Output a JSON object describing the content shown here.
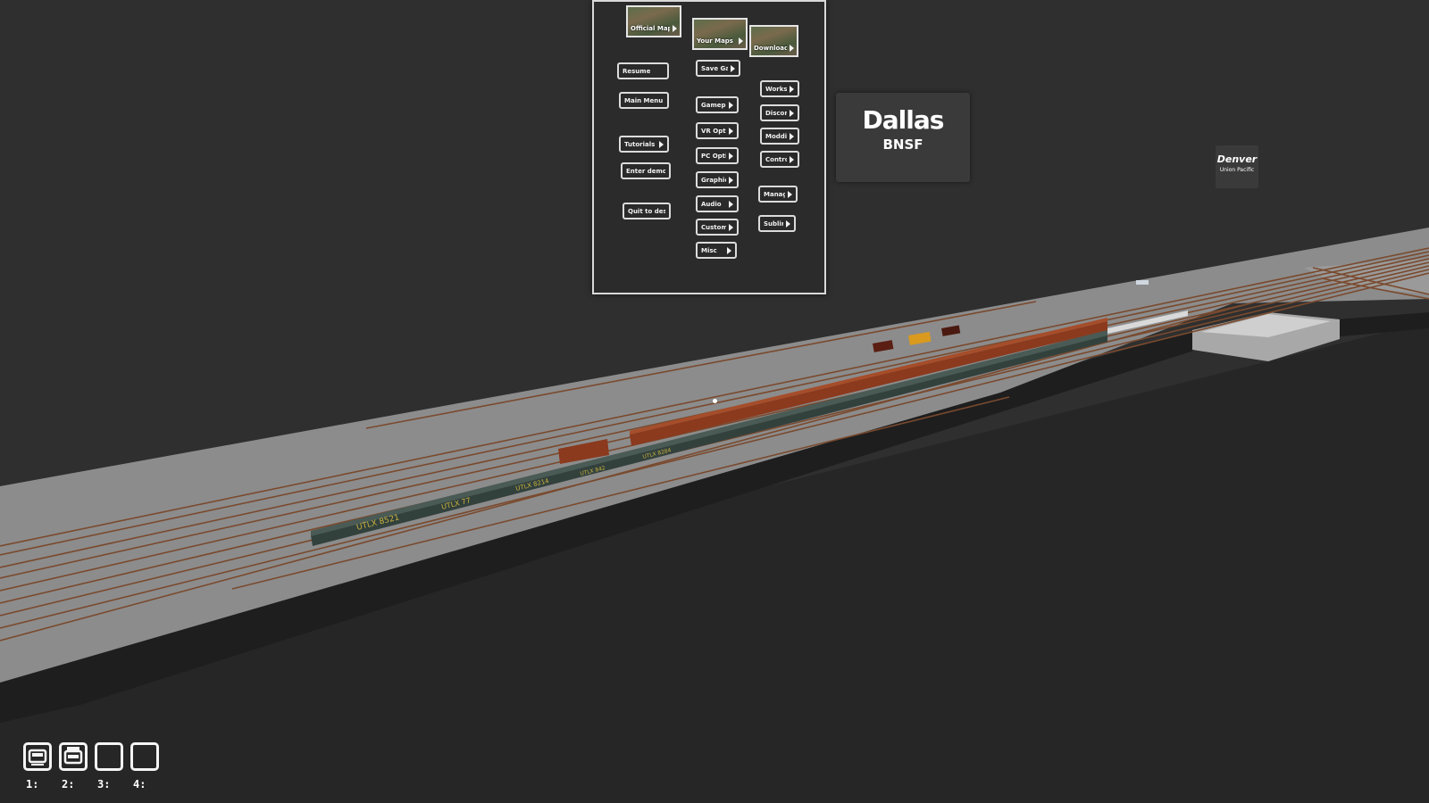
{
  "menu": {
    "map_tiles": [
      {
        "label": "Official Maps"
      },
      {
        "label": "Your Maps"
      },
      {
        "label": "Downloaded Maps"
      }
    ],
    "col1": [
      {
        "label": "Resume"
      },
      {
        "label": "Main Menu"
      },
      {
        "label": "Tutorials"
      },
      {
        "label": "Enter demo mode"
      },
      {
        "label": "Quit to desktop"
      }
    ],
    "col2": [
      {
        "label": "Save Game"
      },
      {
        "label": "Gameplay"
      },
      {
        "label": "VR Options"
      },
      {
        "label": "PC Options"
      },
      {
        "label": "Graphics"
      },
      {
        "label": "Audio"
      },
      {
        "label": "Custom Train"
      },
      {
        "label": "Misc"
      }
    ],
    "col3": [
      {
        "label": "Workshop"
      },
      {
        "label": "Discord"
      },
      {
        "label": "Modding"
      },
      {
        "label": "Controls"
      },
      {
        "label": "Manage Saves"
      },
      {
        "label": "Sublimator"
      }
    ]
  },
  "signs": {
    "dallas": {
      "city": "Dallas",
      "railroad": "BNSF"
    },
    "denver": {
      "city": "Denver",
      "railroad": "Union Pacific"
    }
  },
  "railcars": {
    "tank_markings": [
      "UTLX 8521",
      "UTLX 77",
      "UTLX 8214",
      "UTLX 842",
      "UTLX 8284"
    ]
  },
  "hotbar": {
    "slots": [
      {
        "num": "1:",
        "icon": "train-icon"
      },
      {
        "num": "2:",
        "icon": "caboose-icon"
      },
      {
        "num": "3:",
        "icon": "empty-slot-icon"
      },
      {
        "num": "4:",
        "icon": "empty-slot-icon"
      }
    ]
  },
  "colors": {
    "background": "#2f2f2f",
    "platform": "#8c8c8c",
    "track": "#7a4a2e",
    "boxcar": "#8b3a1e",
    "tankcar": "#33413d"
  }
}
